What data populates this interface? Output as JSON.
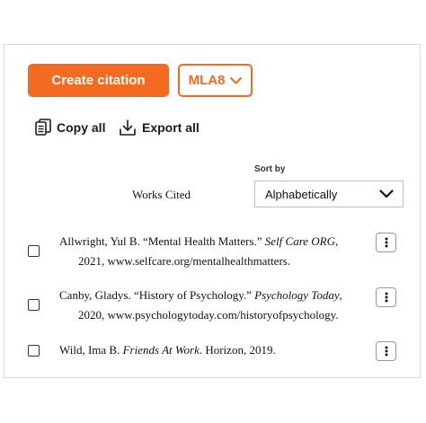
{
  "toolbar": {
    "create_label": "Create citation",
    "style_label": "MLA8",
    "copy_all_label": "Copy all",
    "export_all_label": "Export all"
  },
  "sort": {
    "label": "Sort by",
    "selected": "Alphabetically"
  },
  "heading": "Works Cited",
  "citations": [
    {
      "prefix": "Allwright, Yul B. “Mental Health Matters.” ",
      "italic": "Self Care ORG",
      "suffix": ",",
      "line2": "2021, www.selfcare.org/mentalhealthmatters."
    },
    {
      "prefix": "Canby, Gladys. “History of Psychology.” ",
      "italic": "Psychology Today",
      "suffix": ",",
      "line2": "2020, www.psychologytoday.com/historyofpsychology."
    },
    {
      "prefix": "Wild, Ima B. ",
      "italic": "Friends At Work",
      "suffix": ". Horizon, 2019.",
      "line2": ""
    }
  ],
  "colors": {
    "accent": "#f26b21",
    "text": "#111111",
    "border": "#d9d9d9"
  },
  "icons": {
    "style_dropdown": "chevron-down-icon",
    "copy": "copy-icon",
    "export": "download-icon",
    "sort_dropdown": "chevron-down-icon",
    "row_menu": "more-vertical-icon"
  }
}
